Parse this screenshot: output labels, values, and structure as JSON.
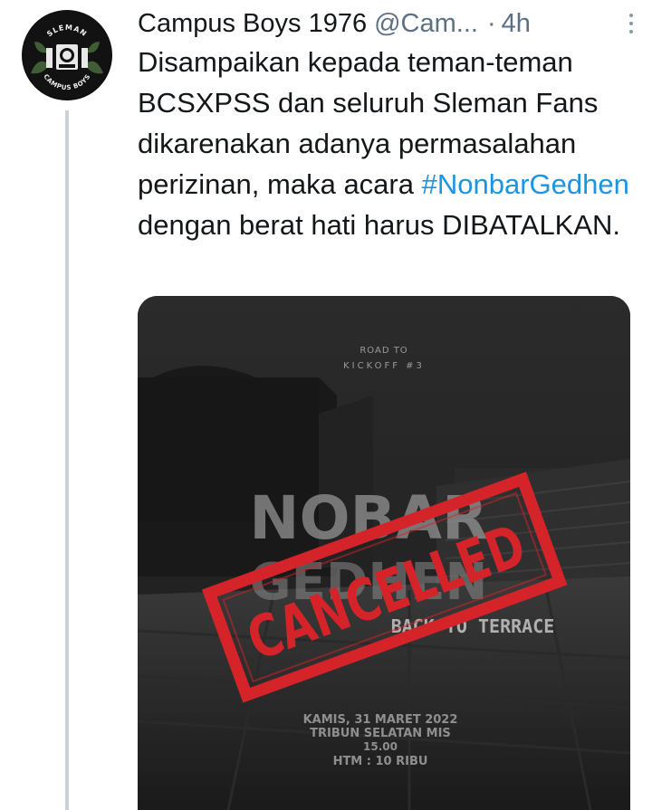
{
  "author": {
    "display_name": "Campus Boys 1976",
    "handle": "@Cam...",
    "time": "4h",
    "avatar_text_top": "SLEMAN",
    "avatar_text_bottom": "CAMPUS BOYS"
  },
  "tweet": {
    "text_before": "Disampaikan kepada teman-teman BCSXPSS dan seluruh Sleman Fans dikarenakan adanya permasalahan perizinan, maka acara ",
    "hashtag": "#NonbarGedhen",
    "text_after": " dengan berat hati harus DIBATALKAN."
  },
  "poster": {
    "road_to": "ROAD TO",
    "kickoff": "KICKOFF #3",
    "title_top": "NOBAR",
    "title_bottom": "GEDHEN",
    "subtitle": "BACK TO TERRACE",
    "stamp": "CANCELLED",
    "date": "KAMIS, 31 MARET 2022",
    "venue": "TRIBUN SELATAN MIS",
    "hour": "15.00",
    "price": "HTM : 10 RIBU"
  },
  "colors": {
    "hashtag": "#1b95e0",
    "secondary_text": "#5b7083",
    "stamp_red": "#d4242a",
    "thread_line": "#c9d1d7"
  }
}
